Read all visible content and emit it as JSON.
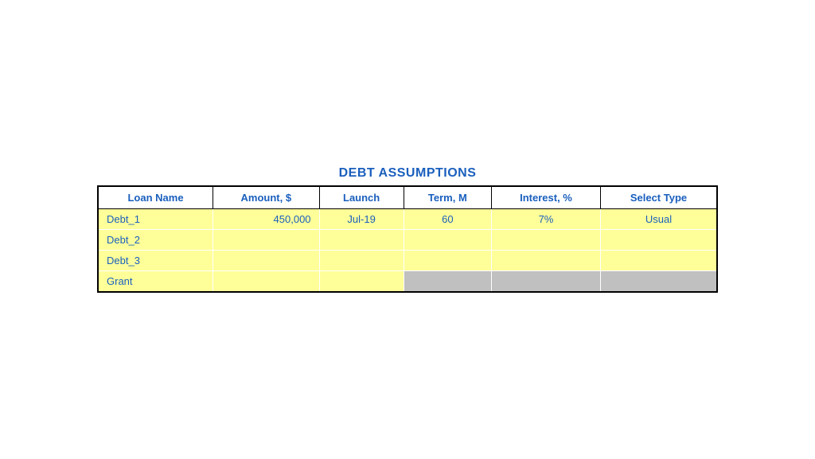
{
  "title": "DEBT ASSUMPTIONS",
  "colors": {
    "header_text": "#1a5fbd",
    "cell_text": "#1a5fbd",
    "row_bg": "#ffff99",
    "gray_bg": "#c0c0c0",
    "border": "#000000"
  },
  "headers": [
    {
      "label": "Loan Name",
      "key": "loan_name"
    },
    {
      "label": "Amount, $",
      "key": "amount"
    },
    {
      "label": "Launch",
      "key": "launch"
    },
    {
      "label": "Term, M",
      "key": "term"
    },
    {
      "label": "Interest, %",
      "key": "interest"
    },
    {
      "label": "Select Type",
      "key": "select_type"
    }
  ],
  "rows": [
    {
      "loan_name": "Debt_1",
      "amount": "450,000",
      "launch": "Jul-19",
      "term": "60",
      "interest": "7%",
      "select_type": "Usual",
      "gray_cols": []
    },
    {
      "loan_name": "Debt_2",
      "amount": "",
      "launch": "",
      "term": "",
      "interest": "",
      "select_type": "",
      "gray_cols": []
    },
    {
      "loan_name": "Debt_3",
      "amount": "",
      "launch": "",
      "term": "",
      "interest": "",
      "select_type": "",
      "gray_cols": []
    },
    {
      "loan_name": "Grant",
      "amount": "",
      "launch": "",
      "term": "",
      "interest": "",
      "select_type": "",
      "gray_cols": [
        "term",
        "interest",
        "select_type"
      ]
    }
  ]
}
